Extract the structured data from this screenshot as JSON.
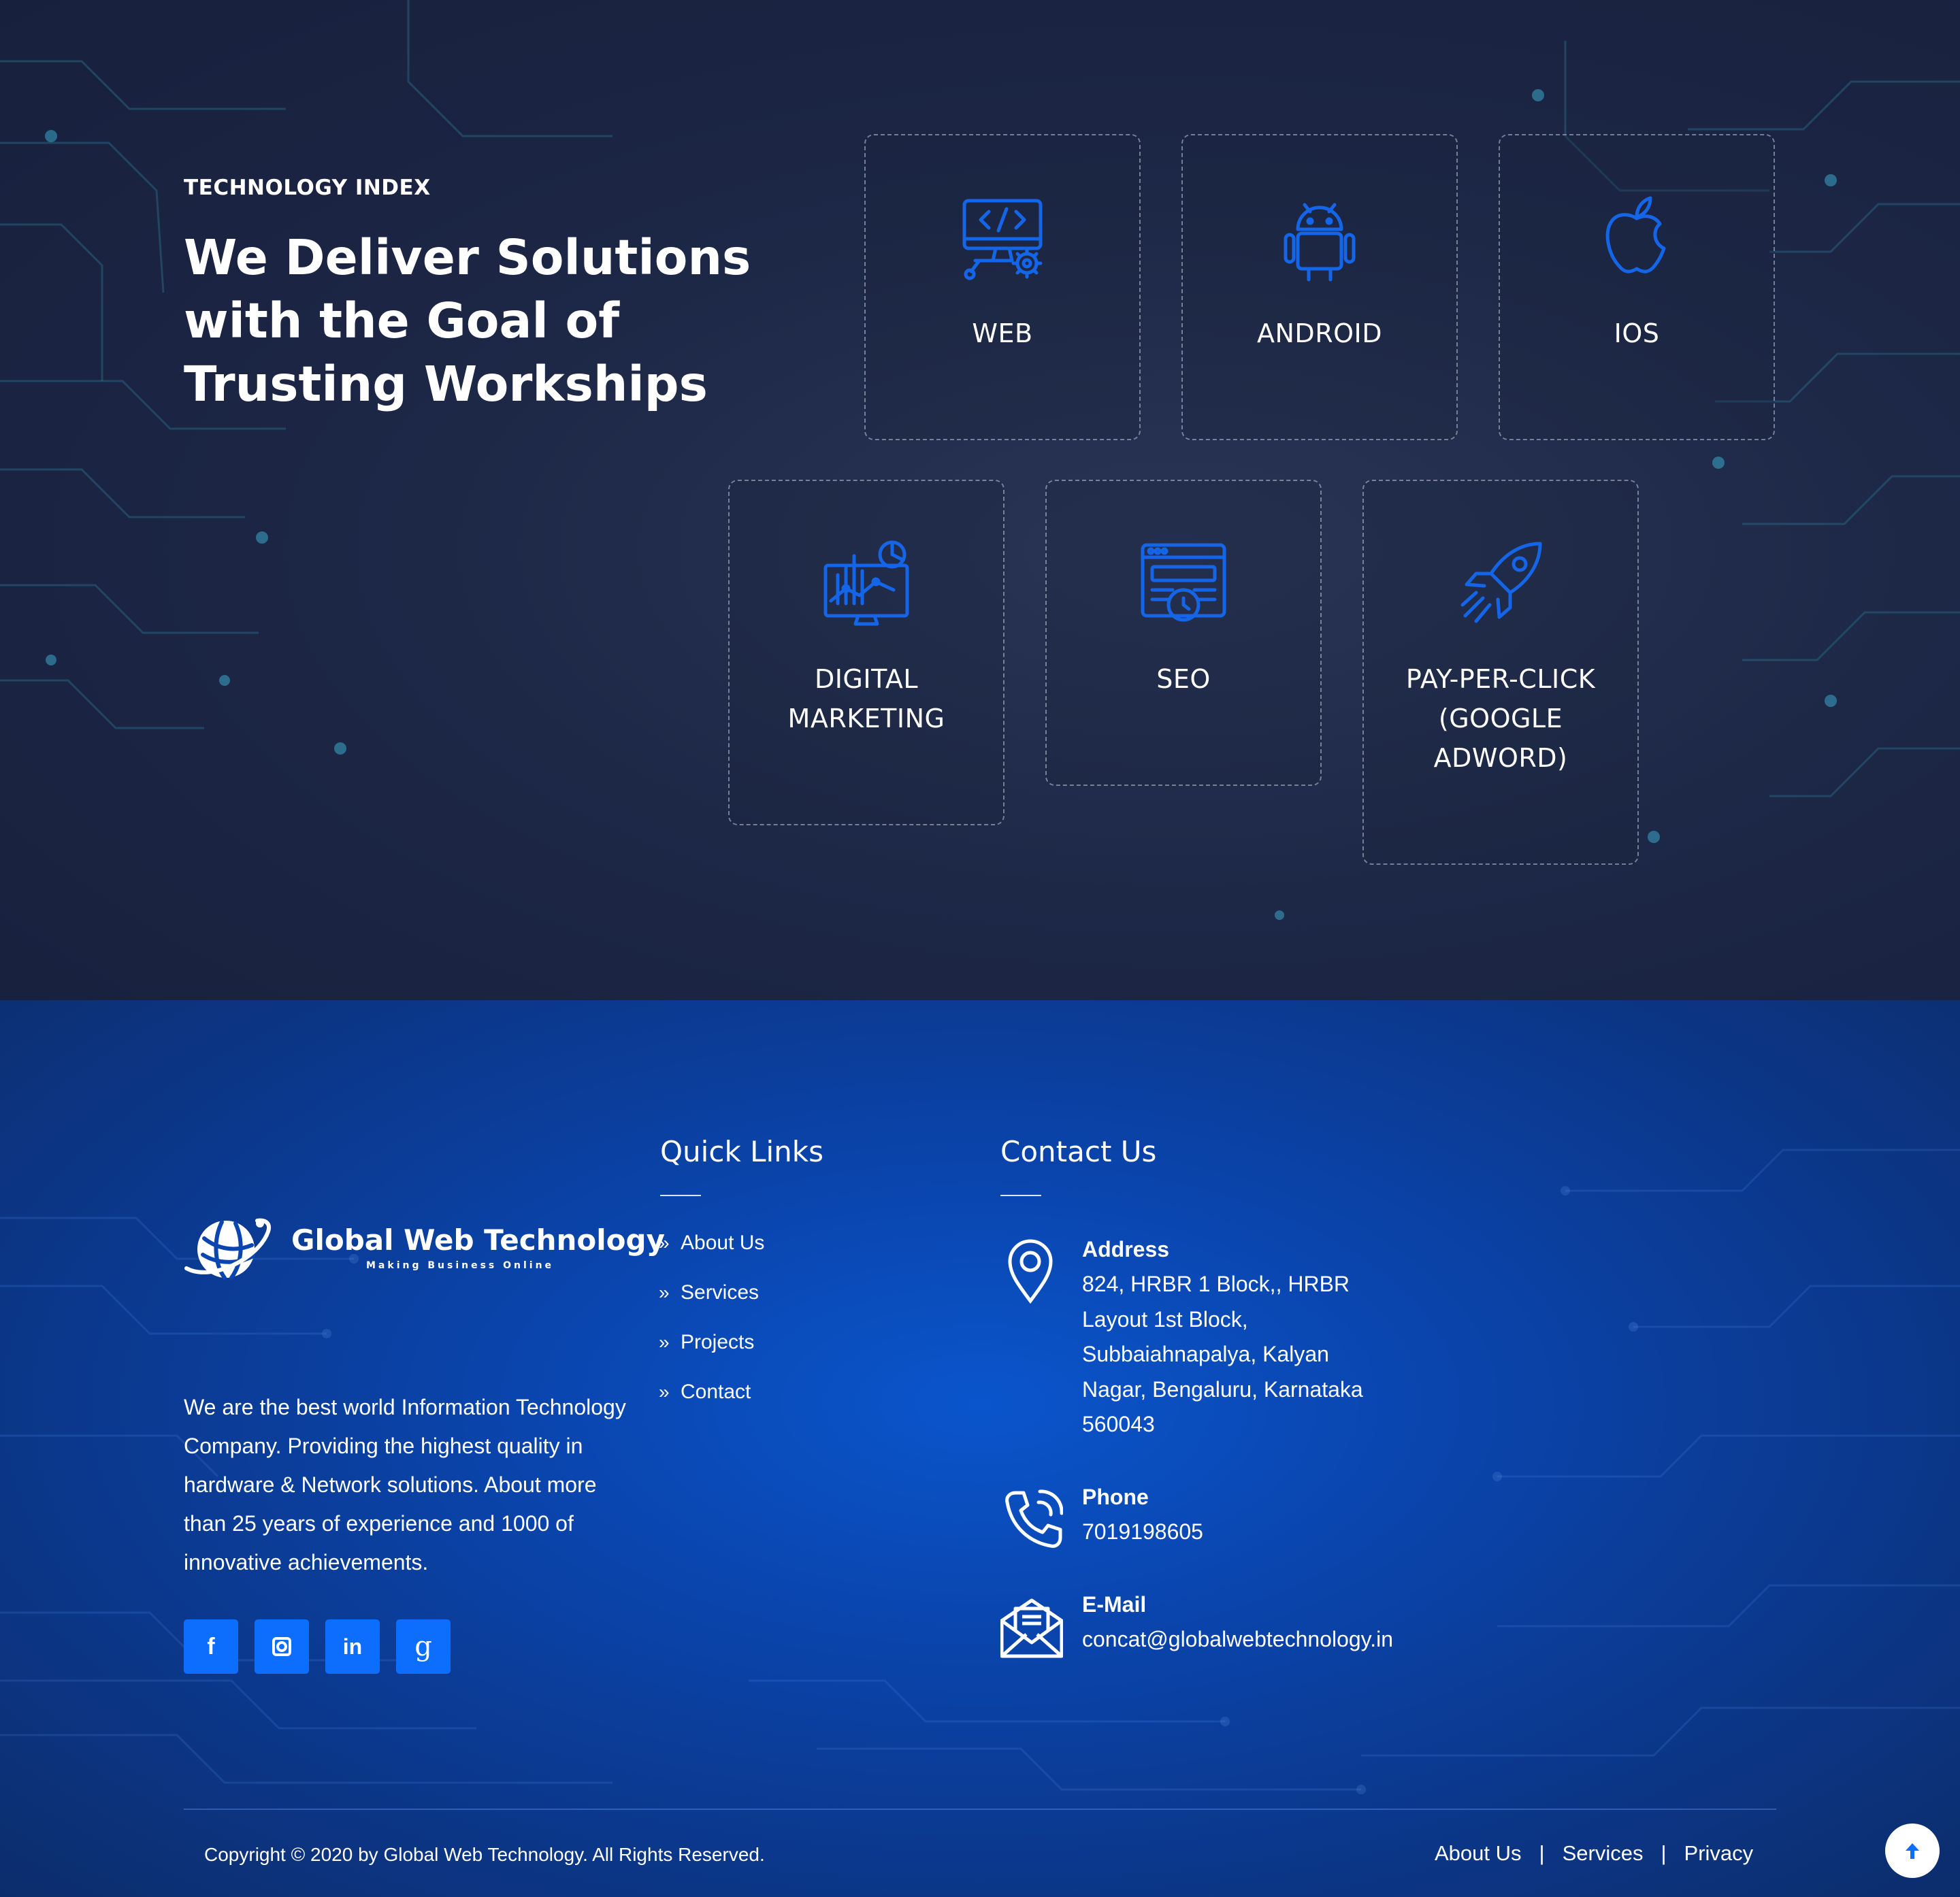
{
  "technology": {
    "eyebrow": "TECHNOLOGY INDEX",
    "heading": "We Deliver Solutions with the Goal of Trusting Workships",
    "cards": [
      {
        "label": "WEB",
        "icon": "web-development-icon"
      },
      {
        "label": "ANDROID",
        "icon": "android-icon"
      },
      {
        "label": "IOS",
        "icon": "apple-icon"
      },
      {
        "label": "DIGITAL MARKETING",
        "icon": "analytics-dashboard-icon"
      },
      {
        "label": "SEO",
        "icon": "seo-browser-icon"
      },
      {
        "label": "PAY-PER-CLICK (GOOGLE ADWORD)",
        "icon": "rocket-icon"
      }
    ]
  },
  "footer": {
    "logo": {
      "name": "Global Web Technology",
      "tagline": "Making Business Online"
    },
    "about": "We are the best world Information Technology Company. Providing the highest quality in hardware & Network solutions. About more than 25 years of experience and 1000 of innovative achievements.",
    "social": [
      {
        "glyph": "f",
        "icon": "facebook-icon"
      },
      {
        "glyph": "",
        "icon": "instagram-icon"
      },
      {
        "glyph": "in",
        "icon": "linkedin-icon"
      },
      {
        "glyph": "g",
        "icon": "google-icon"
      }
    ],
    "quick_links": {
      "title": "Quick Links",
      "arrow": "»",
      "items": [
        "About Us",
        "Services",
        "Projects",
        "Contact"
      ]
    },
    "contact": {
      "title": "Contact Us",
      "address": {
        "label": "Address",
        "value": "824, HRBR 1 Block,, HRBR Layout 1st Block, Subbaiahnapalya, Kalyan Nagar, Bengaluru, Karnataka 560043"
      },
      "phone": {
        "label": "Phone",
        "value": "7019198605"
      },
      "email": {
        "label": "E-Mail",
        "value": "concat@globalwebtechnology.in"
      }
    },
    "copyright": "Copyright © 2020 by Global Web Technology. All Rights Reserved.",
    "bottom_links": [
      "About Us",
      "Services",
      "Privacy"
    ],
    "separator": "|"
  },
  "colors": {
    "accent": "#0d6efd",
    "icon_blue": "#1565e8",
    "dark_bg": "#1d2746",
    "footer_blue": "#0a46b0"
  }
}
